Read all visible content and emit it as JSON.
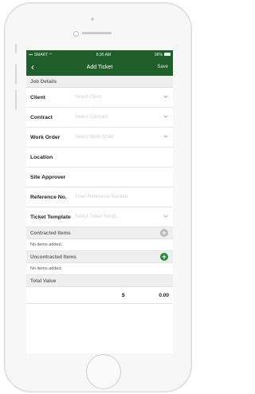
{
  "status_bar": {
    "carrier": "SMART",
    "time": "8:30 AM",
    "battery": "96%"
  },
  "navbar": {
    "title": "Add Ticket",
    "save_label": "Save"
  },
  "sections": {
    "job_details": "Job Details",
    "contracted_items": "Contracted Items",
    "uncontracted_items": "Uncontracted Items",
    "total_value": "Total Value"
  },
  "fields": {
    "client": {
      "label": "Client",
      "placeholder": "Select Client"
    },
    "contract": {
      "label": "Contract",
      "placeholder": "Select Contract"
    },
    "work_order": {
      "label": "Work Order",
      "placeholder": "Select Work Order"
    },
    "location": {
      "label": "Location"
    },
    "site_approver": {
      "label": "Site Approver"
    },
    "reference_no": {
      "label": "Reference No.",
      "placeholder": "Enter Reference Number"
    },
    "ticket_template": {
      "label": "Ticket Template",
      "placeholder": "Select Ticket Templ..."
    }
  },
  "contracted_empty": "No items added.",
  "uncontracted_empty": "No items added.",
  "total": {
    "currency": "$",
    "amount": "0.00"
  },
  "colors": {
    "brand": "#1f5e2b",
    "add_active": "#2f8a3e",
    "add_disabled": "#bcbcc0"
  }
}
